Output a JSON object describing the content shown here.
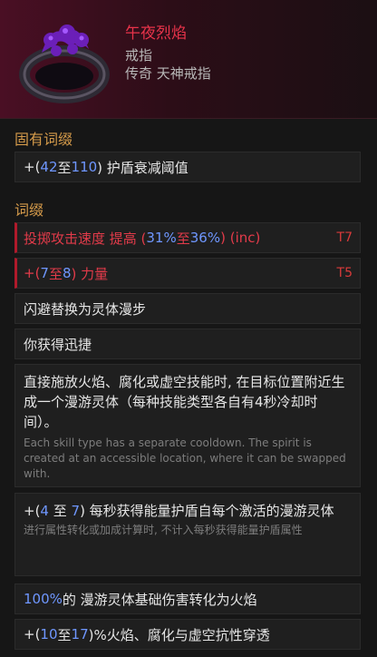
{
  "item": {
    "name": "午夜烈焰",
    "type": "戒指",
    "rarity": "传奇 天神戒指"
  },
  "sections": {
    "implicit_title": "固有词缀",
    "affix_title": "词缀"
  },
  "implicit": {
    "prefix": "+(",
    "min": "42",
    "to": " 至 ",
    "max": "110",
    "suffix": ") 护盾衰减阈值"
  },
  "affixes": [
    {
      "text_pre": "投掷攻击速度 提高 (",
      "min": "31%",
      "to": " 至 ",
      "max": "36%",
      "text_post": ") (inc)",
      "tier": "T7"
    },
    {
      "text_pre": "+(",
      "min": "7",
      "to": " 至 ",
      "max": "8",
      "text_post": ") 力量",
      "tier": "T5"
    }
  ],
  "uniques": {
    "line1": "闪避替换为灵体漫步",
    "line2": "你获得迅捷",
    "line3_main": "直接施放火焰、腐化或虚空技能时, 在目标位置附近生成一个漫游灵体（每种技能类型各自有4秒冷却时间）。",
    "line3_desc": "Each skill type has a separate cooldown. The spirit is created at an accessible location, where it can be swapped with.",
    "line4_prefix": "+(",
    "line4_min": "4",
    "line4_to": " 至 ",
    "line4_max": "7",
    "line4_suffix": ") 每秒获得能量护盾自每个激活的漫游灵体",
    "line4_desc": "进行属性转化或加成计算时, 不计入每秒获得能量护盾属性",
    "line5_num": "100%",
    "line5_text": " 的 漫游灵体基础伤害转化为火焰",
    "line6_prefix": "+(",
    "line6_min": "10",
    "line6_to": " 至 ",
    "line6_max": "17",
    "line6_suffix": ")%火焰、腐化与虚空抗性穿透"
  }
}
